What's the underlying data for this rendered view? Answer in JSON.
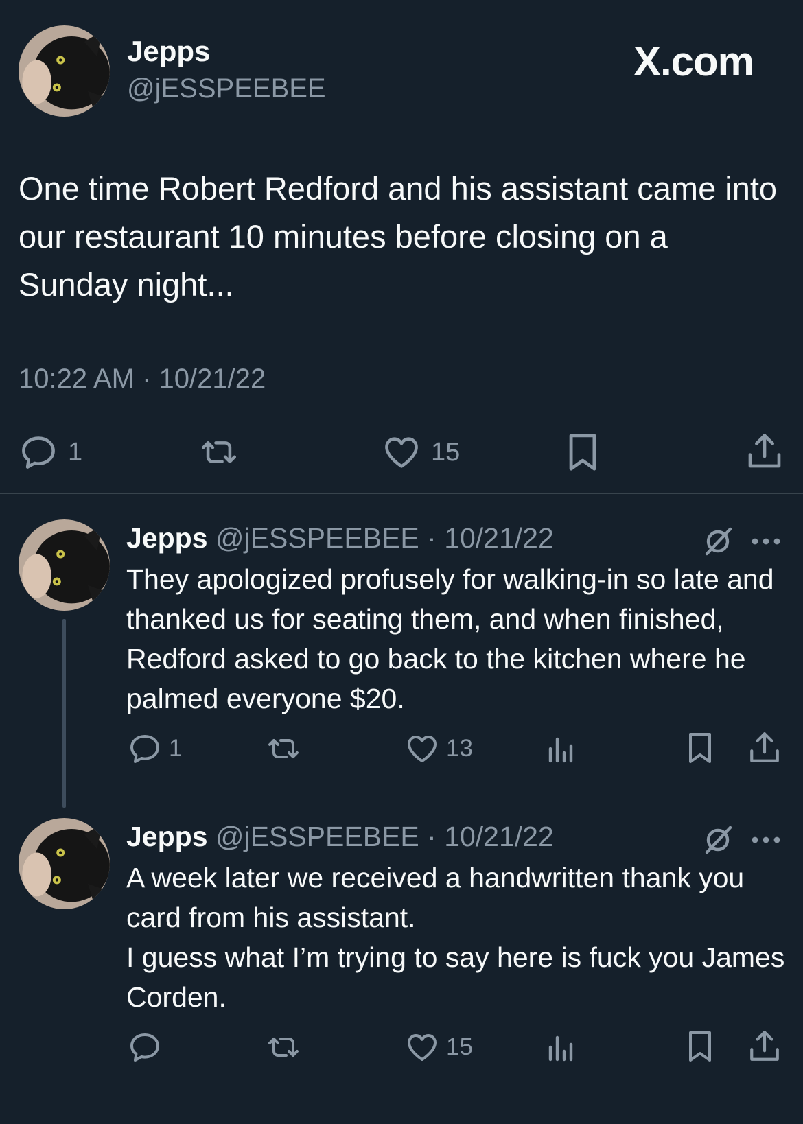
{
  "brand": "X.com",
  "main_tweet": {
    "name": "Jepps",
    "handle": "@jESSPEEBEE",
    "text": "One time Robert Redford and his assistant came into our restaurant 10 minutes before closing on a Sunday night...",
    "timestamp": "10:22 AM · 10/21/22",
    "replies": "1",
    "likes": "15"
  },
  "replies": [
    {
      "name": "Jepps",
      "meta": "@jESSPEEBEE · 10/21/22",
      "text": "They apologized profusely for walking-in so late and thanked us for seating them, and when finished, Redford asked to go back to the kitchen where he palmed everyone $20.",
      "replies": "1",
      "likes": "13"
    },
    {
      "name": "Jepps",
      "meta": "@jESSPEEBEE · 10/21/22",
      "text_lines": [
        "A week later we received a handwritten thank you card from his assistant.",
        "I guess what I’m trying to say here is fuck you James Corden."
      ],
      "likes": "15"
    }
  ],
  "colors": {
    "background": "#15202b",
    "text": "#f7f9f9",
    "secondary": "#8b98a5",
    "divider": "#38444d"
  },
  "icons": [
    "reply-icon",
    "retweet-icon",
    "like-icon",
    "bookmark-icon",
    "share-icon",
    "views-icon",
    "grok-icon",
    "more-icon"
  ]
}
